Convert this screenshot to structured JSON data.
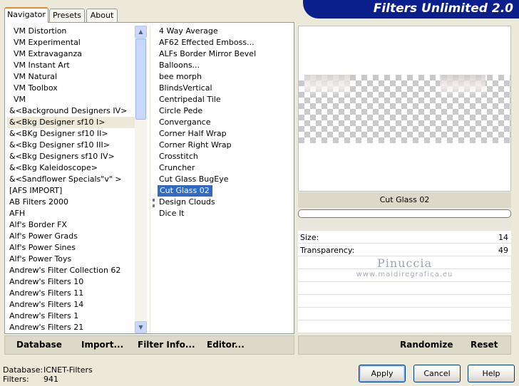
{
  "app": {
    "title": "Filters Unlimited 2.0"
  },
  "tabs": [
    {
      "label": "Navigator"
    },
    {
      "label": "Presets"
    },
    {
      "label": "About"
    }
  ],
  "categories": [
    "VM Distortion",
    "VM Experimental",
    "VM Extravaganza",
    "VM Instant Art",
    "VM Natural",
    "VM Toolbox",
    "VM",
    "&<Background Designers IV>",
    "&<Bkg Designer sf10 I>",
    "&<BKg Designer sf10 II>",
    "&<Bkg Designer sf10 III>",
    "&<Bkg Designers sf10 IV>",
    "&<Bkg Kaleidoscope>",
    "&<Sandflower Specials\"v\" >",
    "[AFS IMPORT]",
    "AB Filters 2000",
    "AFH",
    "Alf's Border FX",
    "Alf's Power Grads",
    "Alf's Power Sines",
    "Alf's Power Toys",
    "Andrew's Filter Collection 62",
    "Andrew's Filters 10",
    "Andrew's Filters 11",
    "Andrew's Filters 14",
    "Andrew's Filters 1",
    "Andrew's Filters 21"
  ],
  "filters": [
    "4 Way Average",
    "AF62 Effected Emboss...",
    "ALFs Border Mirror Bevel",
    "Balloons...",
    "bee morph",
    "BlindsVertical",
    "Centripedal Tile",
    "Circle Pede",
    "Convergance",
    "Corner Half Wrap",
    "Corner Right Wrap",
    "Crosstitch",
    "Cruncher",
    "Cut Glass  BugEye",
    "Cut Glass 02",
    "Design Clouds",
    "Dice It"
  ],
  "preview": {
    "filter_name": "Cut Glass 02"
  },
  "params": [
    {
      "label": "Size:",
      "value": "14"
    },
    {
      "label": "Transparency:",
      "value": "49"
    }
  ],
  "watermark": {
    "name": "Pinuccia",
    "site": "www.maidiregrafica.eu"
  },
  "toolbar": {
    "database_label": "Database",
    "import_label": "Import...",
    "filter_info_label": "Filter Info...",
    "editor_label": "Editor...",
    "randomize_label": "Randomize",
    "reset_label": "Reset"
  },
  "status": {
    "database_label": "Database:",
    "database_value": "ICNET-Filters",
    "filters_label": "Filters:",
    "filters_value": "941"
  },
  "buttons": {
    "apply": "Apply",
    "cancel": "Cancel",
    "help": "Help"
  },
  "colors": {
    "title_banner": "#0B1F8C",
    "selection": "#316AC5",
    "tab_accent": "#E68B2C"
  }
}
